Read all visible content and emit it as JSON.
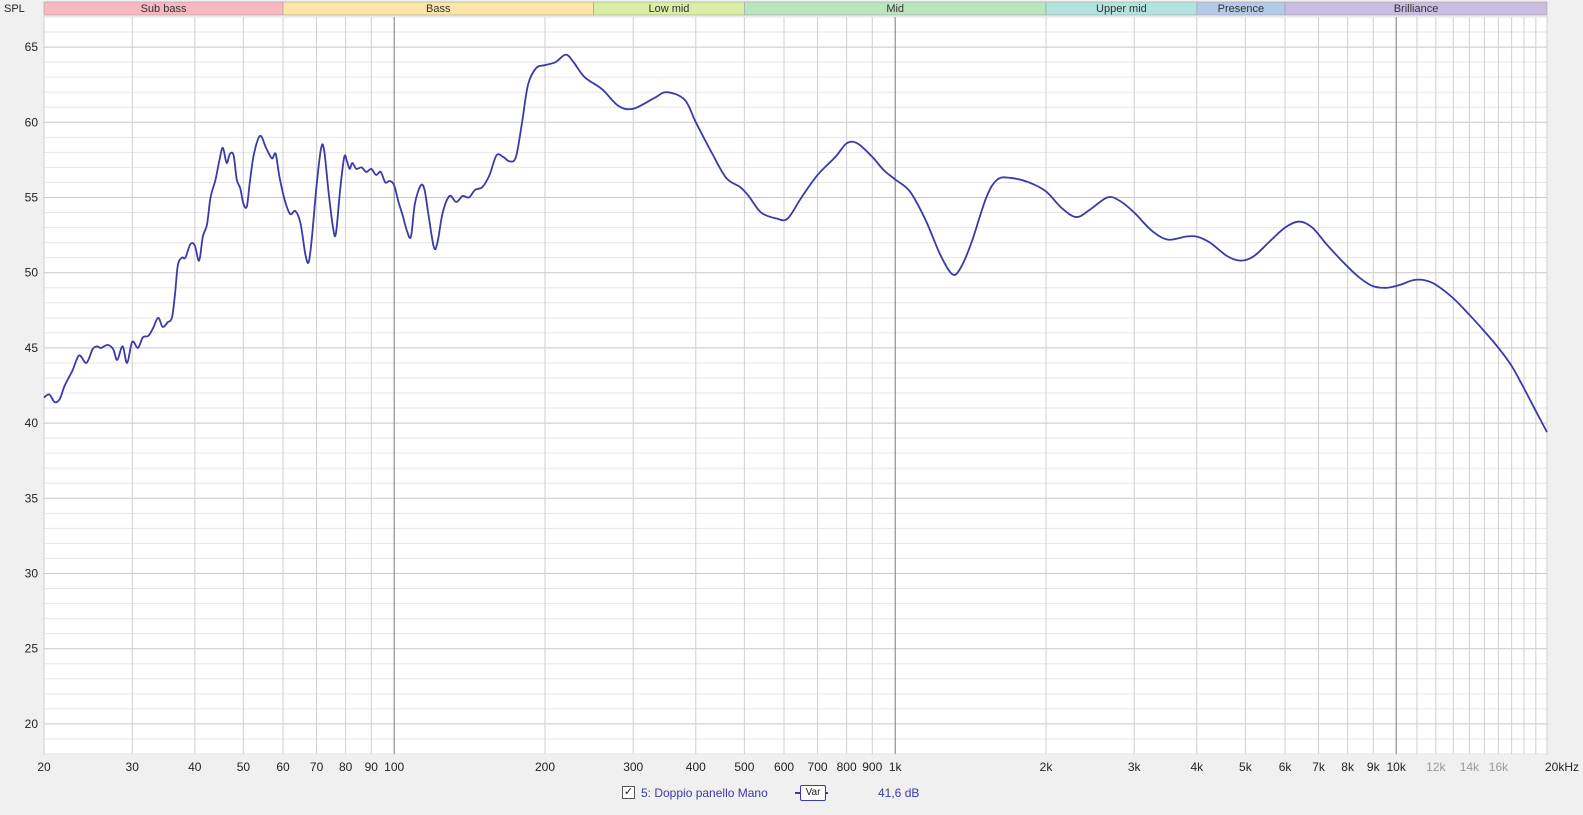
{
  "chart_data": {
    "type": "line",
    "ylabel": "SPL",
    "xscale": "log",
    "xlim": [
      20,
      20000
    ],
    "ylim": [
      18,
      67
    ],
    "x_ticks": [
      {
        "v": 20,
        "label": "20"
      },
      {
        "v": 30,
        "label": "30"
      },
      {
        "v": 40,
        "label": "40"
      },
      {
        "v": 50,
        "label": "50"
      },
      {
        "v": 60,
        "label": "60"
      },
      {
        "v": 70,
        "label": "70"
      },
      {
        "v": 80,
        "label": "80"
      },
      {
        "v": 90,
        "label": "90"
      },
      {
        "v": 100,
        "label": "100"
      },
      {
        "v": 200,
        "label": "200"
      },
      {
        "v": 300,
        "label": "300"
      },
      {
        "v": 400,
        "label": "400"
      },
      {
        "v": 500,
        "label": "500"
      },
      {
        "v": 600,
        "label": "600"
      },
      {
        "v": 700,
        "label": "700"
      },
      {
        "v": 800,
        "label": "800"
      },
      {
        "v": 900,
        "label": "900"
      },
      {
        "v": 1000,
        "label": "1k"
      },
      {
        "v": 2000,
        "label": "2k"
      },
      {
        "v": 3000,
        "label": "3k"
      },
      {
        "v": 4000,
        "label": "4k"
      },
      {
        "v": 5000,
        "label": "5k"
      },
      {
        "v": 6000,
        "label": "6k"
      },
      {
        "v": 7000,
        "label": "7k"
      },
      {
        "v": 8000,
        "label": "8k"
      },
      {
        "v": 9000,
        "label": "9k"
      },
      {
        "v": 10000,
        "label": "10k"
      },
      {
        "v": 12000,
        "label": "12k",
        "faded": true
      },
      {
        "v": 14000,
        "label": "14k",
        "faded": true
      },
      {
        "v": 16000,
        "label": "16k",
        "faded": true
      },
      {
        "v": 20000,
        "label": "20kHz"
      }
    ],
    "y_ticks": [
      20,
      25,
      30,
      35,
      40,
      45,
      50,
      55,
      60,
      65
    ],
    "bands": [
      {
        "label": "Sub bass",
        "from": 20,
        "to": 60,
        "color": "#f7b8bf"
      },
      {
        "label": "Bass",
        "from": 60,
        "to": 250,
        "color": "#f9e6a8"
      },
      {
        "label": "Low mid",
        "from": 250,
        "to": 500,
        "color": "#d9eda5"
      },
      {
        "label": "Mid",
        "from": 500,
        "to": 2000,
        "color": "#b9e6bf"
      },
      {
        "label": "Upper mid",
        "from": 2000,
        "to": 4000,
        "color": "#b3e3dd"
      },
      {
        "label": "Presence",
        "from": 4000,
        "to": 6000,
        "color": "#b3c9e6"
      },
      {
        "label": "Brilliance",
        "from": 6000,
        "to": 20000,
        "color": "#cbbde0"
      }
    ],
    "series": [
      {
        "name": "5: Doppio panello Mano",
        "color": "#3a3aa8",
        "points": [
          [
            20,
            41.7
          ],
          [
            20.5,
            41.9
          ],
          [
            21,
            41.4
          ],
          [
            21.5,
            41.6
          ],
          [
            22,
            42.5
          ],
          [
            22.8,
            43.5
          ],
          [
            23.5,
            44.5
          ],
          [
            24.3,
            44.0
          ],
          [
            25,
            44.9
          ],
          [
            25.5,
            45.1
          ],
          [
            26,
            45.0
          ],
          [
            26.8,
            45.2
          ],
          [
            27.5,
            44.9
          ],
          [
            28,
            44.2
          ],
          [
            28.7,
            45.1
          ],
          [
            29.3,
            44.0
          ],
          [
            30,
            45.4
          ],
          [
            30.8,
            45.0
          ],
          [
            31.5,
            45.7
          ],
          [
            32.3,
            45.8
          ],
          [
            33,
            46.3
          ],
          [
            33.8,
            47.0
          ],
          [
            34.5,
            46.4
          ],
          [
            35.3,
            46.7
          ],
          [
            36,
            47.0
          ],
          [
            36.5,
            48.5
          ],
          [
            37,
            50.5
          ],
          [
            37.7,
            51.0
          ],
          [
            38.3,
            51.0
          ],
          [
            39.2,
            51.9
          ],
          [
            40,
            51.8
          ],
          [
            40.8,
            50.8
          ],
          [
            41.5,
            52.4
          ],
          [
            42.3,
            53.2
          ],
          [
            43,
            55.0
          ],
          [
            44,
            56.2
          ],
          [
            44.8,
            57.5
          ],
          [
            45.5,
            58.3
          ],
          [
            46.3,
            57.3
          ],
          [
            47,
            57.9
          ],
          [
            47.8,
            57.8
          ],
          [
            48.5,
            56.2
          ],
          [
            49.3,
            55.6
          ],
          [
            50,
            54.6
          ],
          [
            50.8,
            54.4
          ],
          [
            51.5,
            56.0
          ],
          [
            52.5,
            57.9
          ],
          [
            54,
            59.1
          ],
          [
            55.5,
            58.3
          ],
          [
            57,
            57.6
          ],
          [
            58,
            57.9
          ],
          [
            59,
            56.4
          ],
          [
            60.5,
            54.8
          ],
          [
            62,
            53.9
          ],
          [
            63.5,
            54.1
          ],
          [
            65,
            53.3
          ],
          [
            66.5,
            51.2
          ],
          [
            67.5,
            50.7
          ],
          [
            68.5,
            52.3
          ],
          [
            70,
            55.8
          ],
          [
            71.5,
            58.3
          ],
          [
            72.5,
            58.1
          ],
          [
            74,
            55.3
          ],
          [
            75.5,
            53.0
          ],
          [
            76.5,
            52.6
          ],
          [
            78,
            55.5
          ],
          [
            79.5,
            57.7
          ],
          [
            80.5,
            57.4
          ],
          [
            81.5,
            56.9
          ],
          [
            82.5,
            57.3
          ],
          [
            84,
            56.9
          ],
          [
            86,
            57.0
          ],
          [
            88,
            56.7
          ],
          [
            90,
            56.9
          ],
          [
            92,
            56.5
          ],
          [
            94,
            56.7
          ],
          [
            96,
            56.0
          ],
          [
            98,
            56.1
          ],
          [
            100,
            55.8
          ],
          [
            102,
            54.7
          ],
          [
            104,
            53.8
          ],
          [
            106,
            52.8
          ],
          [
            108,
            52.4
          ],
          [
            110,
            54.6
          ],
          [
            113,
            55.8
          ],
          [
            115,
            55.5
          ],
          [
            117,
            53.9
          ],
          [
            120,
            51.7
          ],
          [
            122,
            52.0
          ],
          [
            125,
            54.0
          ],
          [
            129,
            55.1
          ],
          [
            133,
            54.7
          ],
          [
            137,
            55.1
          ],
          [
            141,
            55.0
          ],
          [
            145,
            55.5
          ],
          [
            150,
            55.7
          ],
          [
            155,
            56.5
          ],
          [
            160,
            57.8
          ],
          [
            165,
            57.7
          ],
          [
            170,
            57.4
          ],
          [
            175,
            57.7
          ],
          [
            180,
            60.0
          ],
          [
            185,
            62.5
          ],
          [
            192,
            63.6
          ],
          [
            200,
            63.8
          ],
          [
            210,
            64.0
          ],
          [
            220,
            64.5
          ],
          [
            228,
            64.0
          ],
          [
            240,
            63.0
          ],
          [
            260,
            62.2
          ],
          [
            280,
            61.1
          ],
          [
            300,
            60.9
          ],
          [
            330,
            61.6
          ],
          [
            350,
            62.0
          ],
          [
            380,
            61.5
          ],
          [
            400,
            60.0
          ],
          [
            430,
            58.0
          ],
          [
            460,
            56.3
          ],
          [
            490,
            55.7
          ],
          [
            510,
            55.1
          ],
          [
            540,
            54.0
          ],
          [
            580,
            53.6
          ],
          [
            610,
            53.6
          ],
          [
            650,
            55.0
          ],
          [
            700,
            56.5
          ],
          [
            760,
            57.7
          ],
          [
            800,
            58.6
          ],
          [
            840,
            58.6
          ],
          [
            900,
            57.7
          ],
          [
            950,
            56.8
          ],
          [
            1000,
            56.2
          ],
          [
            1070,
            55.4
          ],
          [
            1150,
            53.5
          ],
          [
            1230,
            51.2
          ],
          [
            1300,
            49.9
          ],
          [
            1350,
            50.3
          ],
          [
            1420,
            52.0
          ],
          [
            1520,
            55.0
          ],
          [
            1600,
            56.2
          ],
          [
            1700,
            56.3
          ],
          [
            1850,
            56.0
          ],
          [
            2000,
            55.4
          ],
          [
            2150,
            54.3
          ],
          [
            2300,
            53.7
          ],
          [
            2450,
            54.2
          ],
          [
            2650,
            55.0
          ],
          [
            2800,
            54.8
          ],
          [
            3000,
            54.0
          ],
          [
            3250,
            52.8
          ],
          [
            3500,
            52.2
          ],
          [
            3800,
            52.4
          ],
          [
            4000,
            52.4
          ],
          [
            4250,
            52.0
          ],
          [
            4600,
            51.1
          ],
          [
            4900,
            50.8
          ],
          [
            5200,
            51.1
          ],
          [
            5600,
            52.1
          ],
          [
            6000,
            53.0
          ],
          [
            6400,
            53.4
          ],
          [
            6800,
            53.0
          ],
          [
            7300,
            51.8
          ],
          [
            8000,
            50.4
          ],
          [
            8500,
            49.6
          ],
          [
            9000,
            49.1
          ],
          [
            9600,
            49.0
          ],
          [
            10200,
            49.2
          ],
          [
            10800,
            49.5
          ],
          [
            11400,
            49.5
          ],
          [
            12000,
            49.2
          ],
          [
            13000,
            48.3
          ],
          [
            14000,
            47.2
          ],
          [
            15000,
            46.1
          ],
          [
            16000,
            45.0
          ],
          [
            17000,
            43.8
          ],
          [
            18000,
            42.3
          ],
          [
            19000,
            40.8
          ],
          [
            20000,
            39.4
          ]
        ]
      }
    ]
  },
  "legend": {
    "checkbox_mark": "✓",
    "series_label": "5: Doppio panello Mano",
    "var_label": "Var",
    "cursor_value": "41,6 dB"
  }
}
